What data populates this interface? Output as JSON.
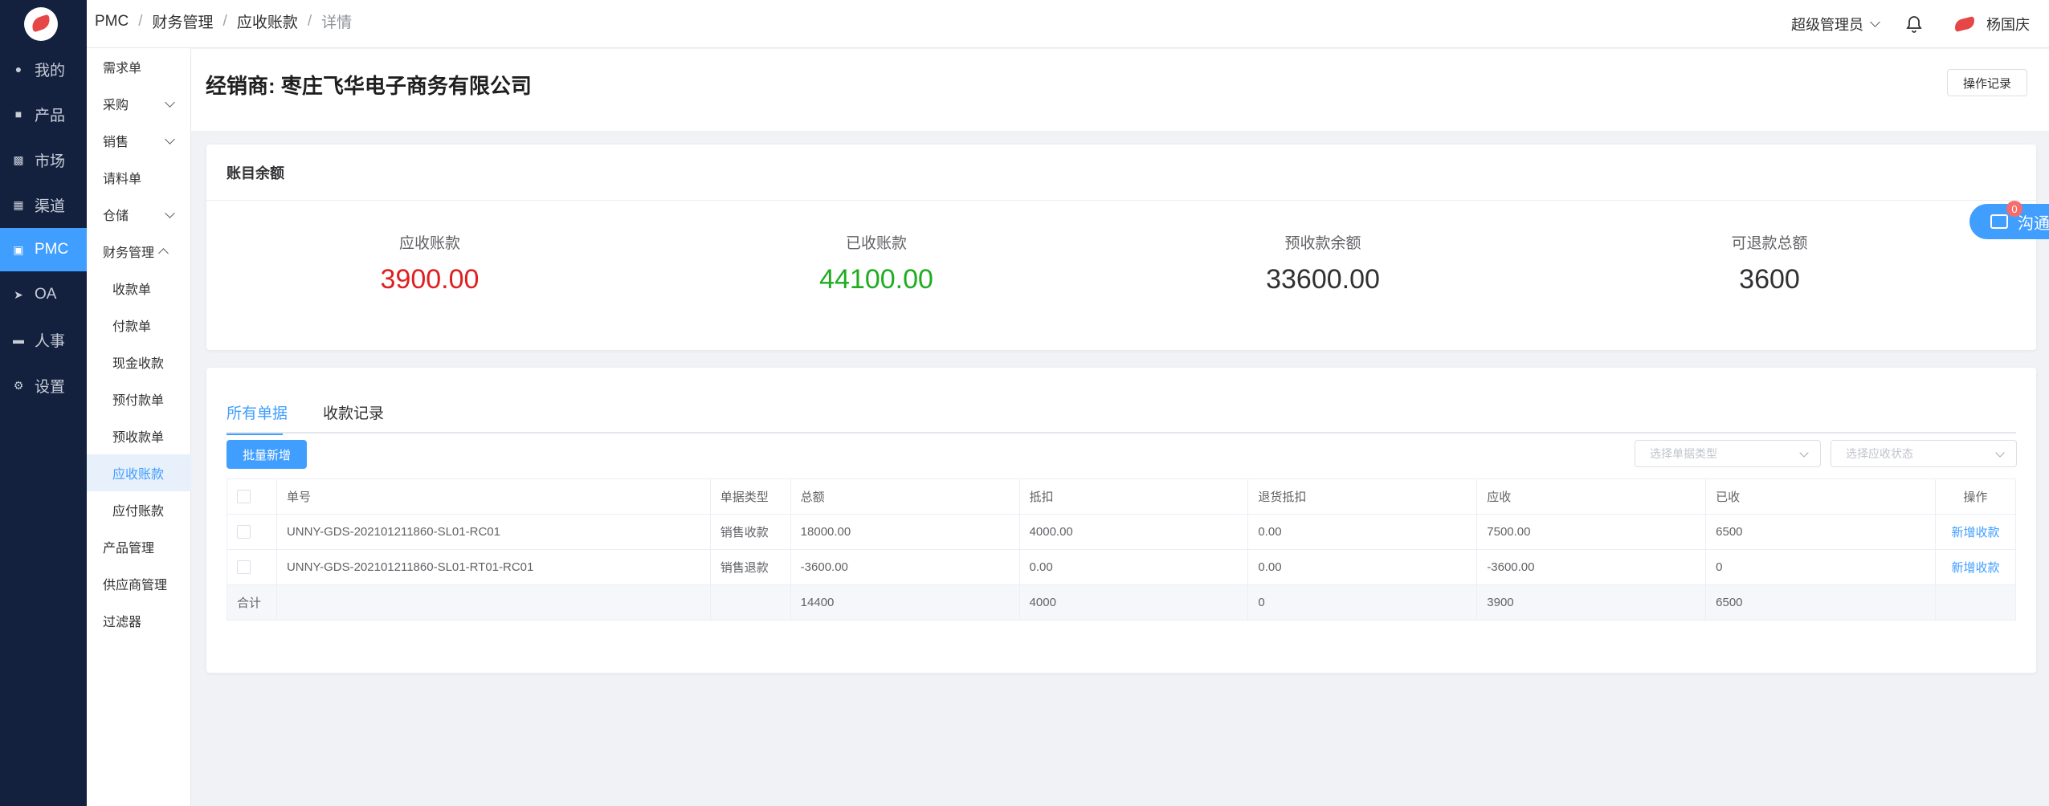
{
  "nav": {
    "items": [
      {
        "label": "我的",
        "icon": "user-icon"
      },
      {
        "label": "产品",
        "icon": "briefcase-icon"
      },
      {
        "label": "市场",
        "icon": "bar-chart-icon"
      },
      {
        "label": "渠道",
        "icon": "grid-icon"
      },
      {
        "label": "PMC",
        "icon": "clipboard-icon"
      },
      {
        "label": "OA",
        "icon": "send-icon"
      },
      {
        "label": "人事",
        "icon": "monitor-icon"
      },
      {
        "label": "设置",
        "icon": "gear-icon"
      }
    ],
    "active": "PMC"
  },
  "submenu": {
    "items": [
      {
        "label": "需求单"
      },
      {
        "label": "采购"
      },
      {
        "label": "销售"
      },
      {
        "label": "请料单"
      },
      {
        "label": "仓储"
      },
      {
        "label": "财务管理"
      },
      {
        "label": "收款单"
      },
      {
        "label": "付款单"
      },
      {
        "label": "现金收款"
      },
      {
        "label": "预付款单"
      },
      {
        "label": "预收款单"
      },
      {
        "label": "应收账款"
      },
      {
        "label": "应付账款"
      },
      {
        "label": "产品管理"
      },
      {
        "label": "供应商管理"
      },
      {
        "label": "过滤器"
      }
    ],
    "active": "应收账款"
  },
  "header": {
    "breadcrumb": [
      "PMC",
      "财务管理",
      "应收账款",
      "详情"
    ],
    "role": "超级管理员",
    "user_name": "杨国庆"
  },
  "page": {
    "title": "经销商: 枣庄飞华电子商务有限公司",
    "log_button": "操作记录"
  },
  "balance": {
    "title": "账目余额",
    "stats": [
      {
        "label": "应收账款",
        "value": "3900.00",
        "color": "#e02020"
      },
      {
        "label": "已收账款",
        "value": "44100.00",
        "color": "#1fad1f"
      },
      {
        "label": "预收款余额",
        "value": "33600.00",
        "color": "#303133"
      },
      {
        "label": "可退款总额",
        "value": "3600",
        "color": "#303133"
      }
    ]
  },
  "chat": {
    "label": "沟通",
    "badge": "0"
  },
  "docs": {
    "tabs": [
      "所有单据",
      "收款记录"
    ],
    "active_tab": "所有单据",
    "batch_button": "批量新增",
    "filter_type_placeholder": "选择单据类型",
    "filter_status_placeholder": "选择应收状态",
    "columns": [
      "单号",
      "单据类型",
      "总额",
      "抵扣",
      "退货抵扣",
      "应收",
      "已收",
      "操作"
    ],
    "rows": [
      {
        "no": "UNNY-GDS-202101211860-SL01-RC01",
        "type": "销售收款",
        "total": "18000.00",
        "deduct": "4000.00",
        "return_deduct": "0.00",
        "receivable": "7500.00",
        "received": "6500",
        "action": "新增收款"
      },
      {
        "no": "UNNY-GDS-202101211860-SL01-RT01-RC01",
        "type": "销售退款",
        "total": "-3600.00",
        "deduct": "0.00",
        "return_deduct": "0.00",
        "receivable": "-3600.00",
        "received": "0",
        "action": "新增收款"
      }
    ],
    "summary": {
      "label": "合计",
      "total": "14400",
      "deduct": "4000",
      "return_deduct": "0",
      "receivable": "3900",
      "received": "6500"
    }
  }
}
